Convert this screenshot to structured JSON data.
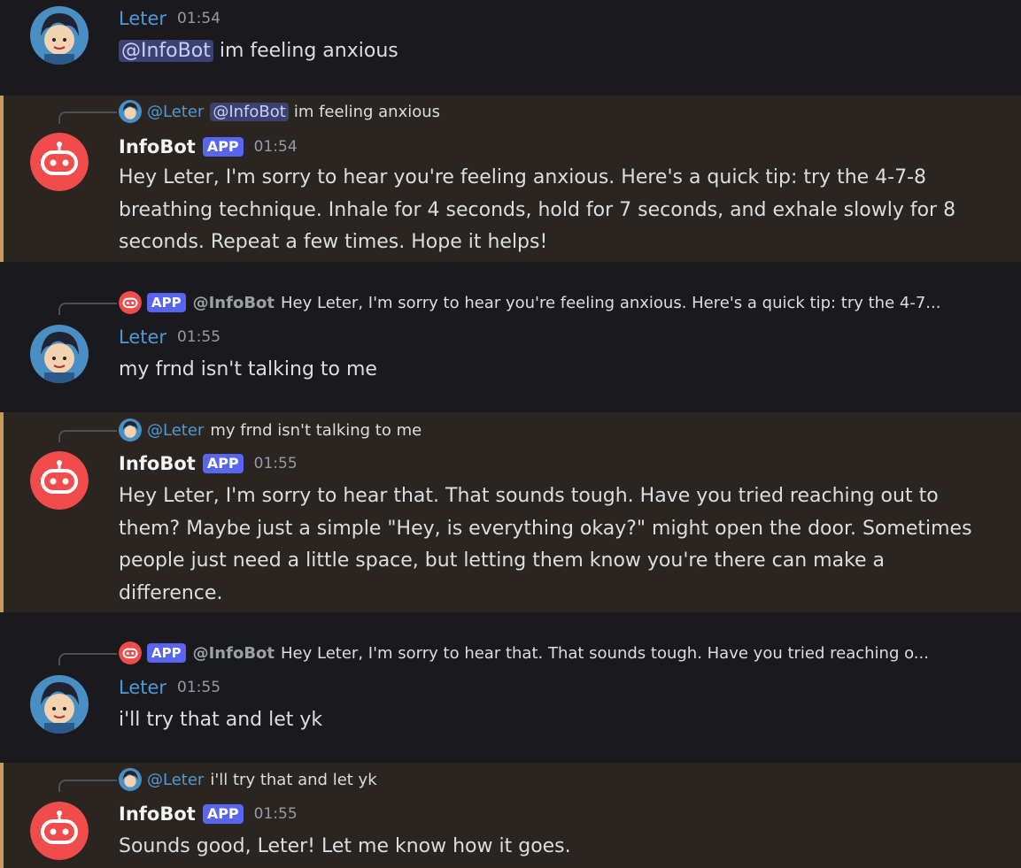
{
  "messages": [
    {
      "author": "Leter",
      "time": "01:54",
      "mention": "@InfoBot",
      "text": "im feeling anxious"
    },
    {
      "author": "InfoBot",
      "app_tag": "APP",
      "time": "01:54",
      "reply_user": "@Leter",
      "reply_mention": "@InfoBot",
      "reply_text": "im feeling anxious",
      "text": "Hey Leter, I'm sorry to hear you're feeling anxious. Here's a quick tip: try the 4-7-8 breathing technique. Inhale for 4 seconds, hold for 7 seconds, and exhale slowly for 8 seconds. Repeat a few times. Hope it helps!"
    },
    {
      "author": "Leter",
      "time": "01:55",
      "reply_app_tag": "APP",
      "reply_user": "@InfoBot",
      "reply_text": "Hey Leter, I'm sorry to hear you're feeling anxious. Here's a quick tip: try the 4-7...",
      "text": "my frnd isn't talking to me"
    },
    {
      "author": "InfoBot",
      "app_tag": "APP",
      "time": "01:55",
      "reply_user": "@Leter",
      "reply_text": "my frnd isn't talking to me",
      "text": "Hey Leter, I'm sorry to hear that. That sounds tough. Have you tried reaching out to them? Maybe just a simple \"Hey, is everything okay?\" might open the door. Sometimes people just need a little space, but letting them know you're there can make a difference."
    },
    {
      "author": "Leter",
      "time": "01:55",
      "reply_app_tag": "APP",
      "reply_user": "@InfoBot",
      "reply_text": "Hey Leter, I'm sorry to hear that. That sounds tough. Have you tried reaching o...",
      "text": "i'll try that and let yk"
    },
    {
      "author": "InfoBot",
      "app_tag": "APP",
      "time": "01:55",
      "reply_user": "@Leter",
      "reply_text": "i'll try that and let yk",
      "text": "Sounds good, Leter! Let me know how it goes."
    }
  ],
  "colors": {
    "background": "#1a1a1e",
    "highlight_background": "#2a2520",
    "highlight_bar": "#c89b58",
    "user_name": "#4e9ad6",
    "app_tag": "#5865f2",
    "bot_avatar": "#f04c4c",
    "mention_bg": "#3c4270"
  },
  "icons": {
    "user_avatar": "anime-boy-avatar",
    "bot_avatar": "robot-face-icon"
  }
}
